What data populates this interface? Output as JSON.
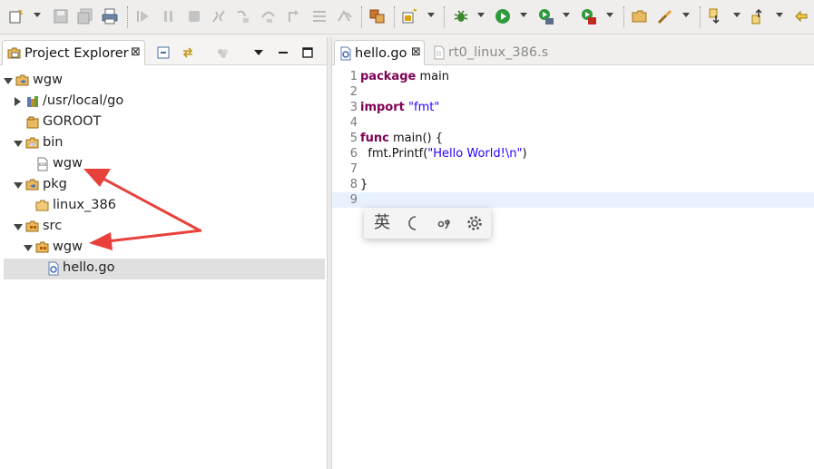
{
  "toolbar": {
    "buttons": [
      "new-icon",
      "save-icon",
      "save-all-icon",
      "print-icon",
      "resume-icon",
      "suspend-icon",
      "terminate-icon",
      "disconnect-icon",
      "step-into-icon",
      "step-over-icon",
      "step-return-icon",
      "drop-to-frame-icon",
      "open-type-icon",
      "new-package-icon",
      "debug-icon",
      "run-icon",
      "coverage-icon",
      "external-tools-icon",
      "open-folder-icon",
      "search-icon",
      "next-annotation-icon",
      "previous-annotation-icon",
      "last-edit-icon"
    ]
  },
  "project_explorer": {
    "tab_label": "Project Explorer",
    "close_glyph": "⊠",
    "tree": [
      {
        "label": "wgw",
        "icon": "project-icon",
        "state": "open"
      },
      {
        "label": "/usr/local/go",
        "icon": "library-icon",
        "state": "closed"
      },
      {
        "label": "GOROOT",
        "icon": "goroot-icon",
        "state": "none"
      },
      {
        "label": "bin",
        "icon": "binary-folder-icon",
        "state": "open"
      },
      {
        "label": "wgw",
        "icon": "binary-file-icon",
        "state": "none"
      },
      {
        "label": "pkg",
        "icon": "package-folder-icon",
        "state": "open"
      },
      {
        "label": "linux_386",
        "icon": "folder-icon",
        "state": "none"
      },
      {
        "label": "src",
        "icon": "source-folder-icon",
        "state": "open"
      },
      {
        "label": "wgw",
        "icon": "package-icon",
        "state": "open"
      },
      {
        "label": "hello.go",
        "icon": "go-file-icon",
        "state": "none",
        "selected": true
      }
    ]
  },
  "editor": {
    "tabs": [
      {
        "label": "hello.go",
        "active": true,
        "close_glyph": "⊠"
      },
      {
        "label": "rt0_linux_386.s",
        "active": false
      }
    ],
    "lines": [
      {
        "n": "1",
        "kw": "package",
        "rest": " main"
      },
      {
        "n": "2",
        "kw": "",
        "rest": ""
      },
      {
        "n": "3",
        "kw": "import",
        "rest": " ",
        "str": "\"fmt\""
      },
      {
        "n": "4",
        "kw": "",
        "rest": ""
      },
      {
        "n": "5",
        "kw": "func",
        "rest": " main() {"
      },
      {
        "n": "6",
        "kw": "",
        "rest": "  fmt.Printf(",
        "str": "\"Hello World!\\n\"",
        "after": ")"
      },
      {
        "n": "7",
        "kw": "",
        "rest": ""
      },
      {
        "n": "8",
        "kw": "",
        "rest": "}"
      },
      {
        "n": "9",
        "kw": "",
        "rest": ""
      }
    ]
  },
  "ime": {
    "lang_char": "英",
    "items": [
      "language-toggle",
      "half-width-moon-icon",
      "punctuation-icon",
      "gear-icon"
    ]
  },
  "colors": {
    "keyword": "#7f0055",
    "string": "#2a00ff",
    "arrow": "#e8413c",
    "selection": "#e0e0e0",
    "current_line": "#e8f2fe"
  }
}
